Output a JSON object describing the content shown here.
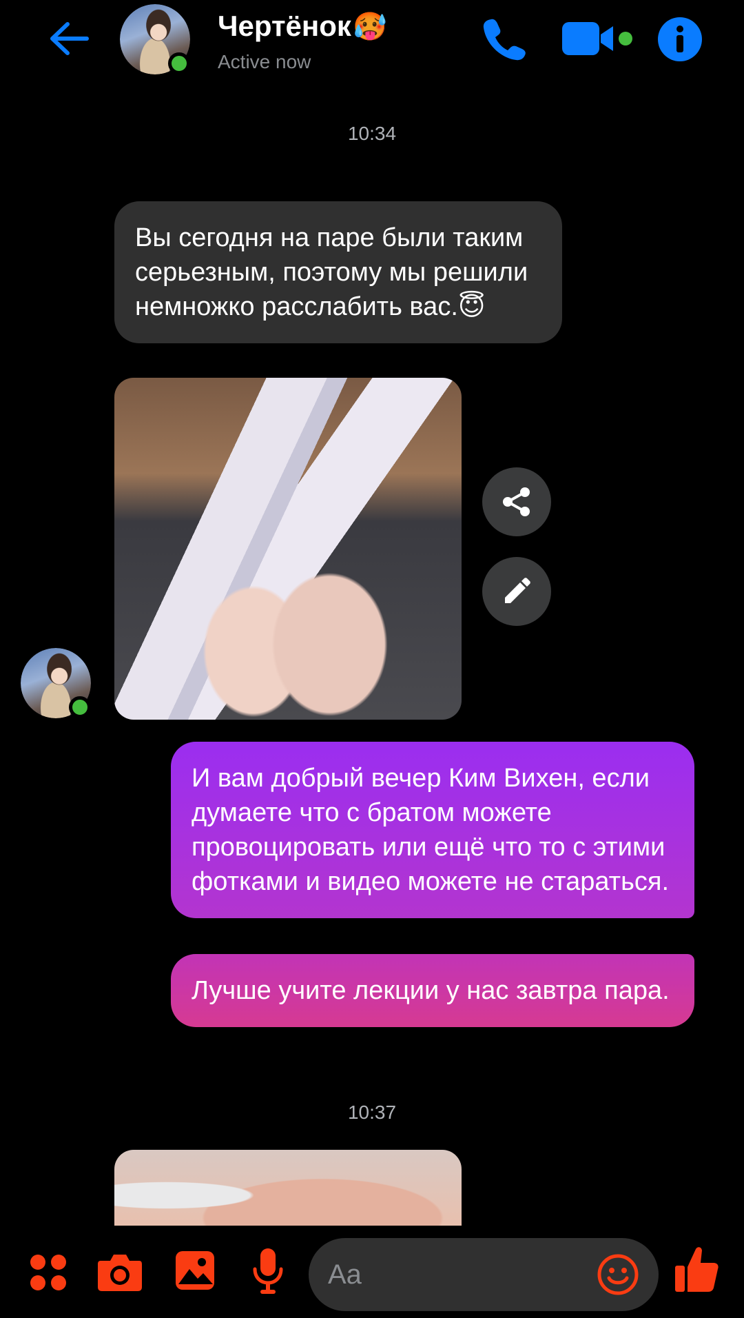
{
  "header": {
    "contact_name": "Чертёнок",
    "name_emoji": "🥵",
    "status": "Active now"
  },
  "colors": {
    "accent": "#0a7cff",
    "online": "#45bd3e",
    "composer_icons": "#fa3c12",
    "incoming_bubble": "#303030",
    "outgoing_top": "#9b2ef0",
    "outgoing_bottom": "#d63a92"
  },
  "chat": {
    "timestamp_1": "10:34",
    "incoming_1": "Вы сегодня на паре были таким серьезным, поэтому мы решили немножко расслабить вас.",
    "incoming_1_emoji": "😇",
    "outgoing_1": "И вам добрый вечер Ким Вихен, если думаете что с братом можете провоцировать или ещё что то с этими фотками и видео можете не стараться.",
    "outgoing_2": "Лучше учите лекции у нас завтра пара.",
    "timestamp_2": "10:37"
  },
  "composer": {
    "placeholder": "Aa"
  },
  "icons": {
    "back": "arrow-left-icon",
    "call": "phone-icon",
    "video": "video-camera-icon",
    "info": "info-icon",
    "share": "share-icon",
    "edit": "pencil-icon",
    "menu": "four-dots-icon",
    "camera": "camera-icon",
    "gallery": "image-icon",
    "mic": "microphone-icon",
    "emoji": "smiley-icon",
    "like": "thumbs-up-icon"
  }
}
